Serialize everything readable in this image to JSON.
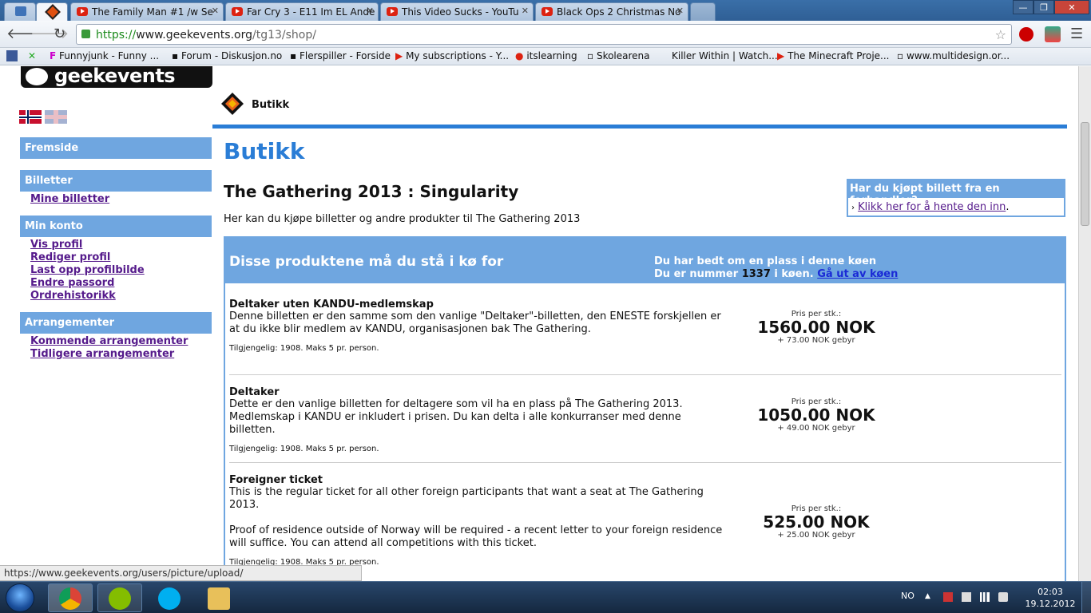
{
  "browser": {
    "tabs": [
      {
        "label": "The Family Man #1 /w Se"
      },
      {
        "label": "Far Cry 3 - E11 Im EL Ande"
      },
      {
        "label": "This Video Sucks - YouTu"
      },
      {
        "label": "Black Ops 2 Christmas No"
      }
    ],
    "url": {
      "scheme": "https://",
      "host": "www.geekevents.org",
      "path": "/tg13/shop/"
    },
    "bookmarks": [
      {
        "label": "Funnyjunk - Funny ..."
      },
      {
        "label": "Forum - Diskusjon.no"
      },
      {
        "label": "Flerspiller - Forside"
      },
      {
        "label": "My subscriptions - Y..."
      },
      {
        "label": "itslearning"
      },
      {
        "label": "Skolearena"
      },
      {
        "label": "Killer Within | Watch..."
      },
      {
        "label": "The Minecraft Proje..."
      },
      {
        "label": "www.multidesign.or..."
      }
    ],
    "status_url": "https://www.geekevents.org/users/picture/upload/"
  },
  "site": {
    "logo_text": "geekevents",
    "sidebar": {
      "sections": [
        {
          "title": "Fremside",
          "links": []
        },
        {
          "title": "Billetter",
          "links": [
            "Mine billetter"
          ]
        },
        {
          "title": "Min konto",
          "links": [
            "Vis profil",
            "Rediger profil",
            "Last opp profilbilde",
            "Endre passord",
            "Ordrehistorikk"
          ]
        },
        {
          "title": "Arrangementer",
          "links": [
            "Kommende arrangementer",
            "Tidligere arrangementer"
          ]
        }
      ]
    },
    "breadcrumb": "Butikk"
  },
  "main": {
    "page_title": "Butikk",
    "event_title": "The Gathering 2013 : Singularity",
    "intro": "Her kan du kjøpe billetter og andre produkter til The Gathering 2013",
    "reseller": {
      "title": "Har du kjøpt billett fra en forhandler?",
      "link": "Klikk her for å hente den inn",
      "suffix": "."
    },
    "queue": {
      "title": "Disse produktene må du stå i kø for",
      "line1": "Du har bedt om en plass i denne køen",
      "line2_prefix": "Du er nummer ",
      "number": "1337",
      "line2_suffix": " i køen. ",
      "leave_link": "Gå ut av køen"
    },
    "products": [
      {
        "name": "Deltaker uten KANDU-medlemskap",
        "desc": "Denne billetten er den samme som den vanlige \"Deltaker\"-billetten, den ENESTE forskjellen er at du ikke blir medlem av KANDU, organisasjonen bak The Gathering.",
        "avail": "Tilgjengelig: 1908. Maks 5 pr. person.",
        "price_label": "Pris per stk.:",
        "price": "1560.00 NOK",
        "fee": "+ 73.00 NOK gebyr"
      },
      {
        "name": "Deltaker",
        "desc": "Dette er den vanlige billetten for deltagere som vil ha en plass på The Gathering 2013. Medlemskap i KANDU er inkludert i prisen. Du kan delta i alle konkurranser med denne billetten.",
        "avail": "Tilgjengelig: 1908. Maks 5 pr. person.",
        "price_label": "Pris per stk.:",
        "price": "1050.00 NOK",
        "fee": "+ 49.00 NOK gebyr"
      },
      {
        "name": "Foreigner ticket",
        "desc": "This is the regular ticket for all other foreign participants that want a seat at The Gathering 2013.",
        "desc2": "Proof of residence outside of Norway will be required - a recent letter to your foreign residence will suffice. You can attend all competitions with this ticket.",
        "avail": "Tilgjengelig: 1908. Maks 5 pr. person.",
        "price_label": "Pris per stk.:",
        "price": "525.00 NOK",
        "fee": "+ 25.00 NOK gebyr"
      }
    ]
  },
  "taskbar": {
    "language": "NO",
    "time": "02:03",
    "date": "19.12.2012"
  },
  "colors": {
    "accent_blue": "#2a7dd6",
    "sidebar_blue": "#6fa6e0",
    "link_purple": "#551a8b"
  }
}
